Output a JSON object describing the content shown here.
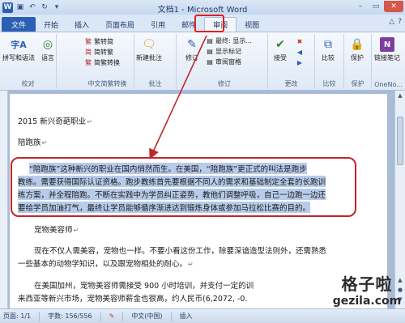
{
  "window": {
    "title": "文档1 - Microsoft Word"
  },
  "tabs": [
    {
      "label": "文件"
    },
    {
      "label": "开始"
    },
    {
      "label": "插入"
    },
    {
      "label": "页面布局"
    },
    {
      "label": "引用"
    },
    {
      "label": "邮件"
    },
    {
      "label": "审阅"
    },
    {
      "label": "视图"
    }
  ],
  "ribbon": {
    "proofing": {
      "label": "校对",
      "spelling": "拼写和语法",
      "language": "语言"
    },
    "chinese": {
      "label": "中文简繁转换",
      "to_traditional": "繁转简",
      "to_simplified": "简转繁",
      "convert": "简繁转换"
    },
    "comments": {
      "label": "批注",
      "new": "新建批注"
    },
    "tracking": {
      "label": "修订",
      "track": "修订",
      "final_display": "最终: 显示...",
      "show_markup": "显示标记",
      "review_pane": "审阅窗格"
    },
    "changes": {
      "label": "更改",
      "accept": "接受"
    },
    "compare": {
      "label": "比较",
      "compare": "比较"
    },
    "protect": {
      "label": "保护",
      "protect": "保护"
    },
    "onenote": {
      "label": "OneNo...",
      "linked_notes": "链接笔记"
    }
  },
  "document": {
    "lines": [
      "2015 新兴奇葩职业",
      "陪跑族",
      "“陪跑族”这种新兴的职业在国内悄然而生。在美国，“陪跑族”更正式的叫法是跑步",
      "教练。需要获得国际认证资格。跑步教练首先要根据不同人的需求和基础制定全套的长跑训",
      "练方案，并全程陪跑。不断在实践中为学员纠正姿势，教他们调整呼吸，自己一边跑一边还",
      "要给学员加油打气，最终让学员能够循序渐进达到锻炼身体或参加马拉松比赛的目的。",
      "宠物美容师",
      "现在不仅人需美容，宠物也一样。不要小看这份工作，除要深谙造型法则外，还需熟悉",
      "一些基本的动物学知识，以及跟宠物相处的耐心。",
      "在美国加州，宠物美容师需接受 900 小时培训，并支付一定的训",
      "来西亚等新兴市场，宠物美容师薪金也很高，约人民币(6,2072, -0."
    ]
  },
  "status": {
    "page": "页面: 1/1",
    "words": "字数: 156/556",
    "language": "中文(中国)",
    "mode": "插入"
  },
  "watermark": {
    "line1": "格子啦",
    "line2": "gezila.com"
  }
}
